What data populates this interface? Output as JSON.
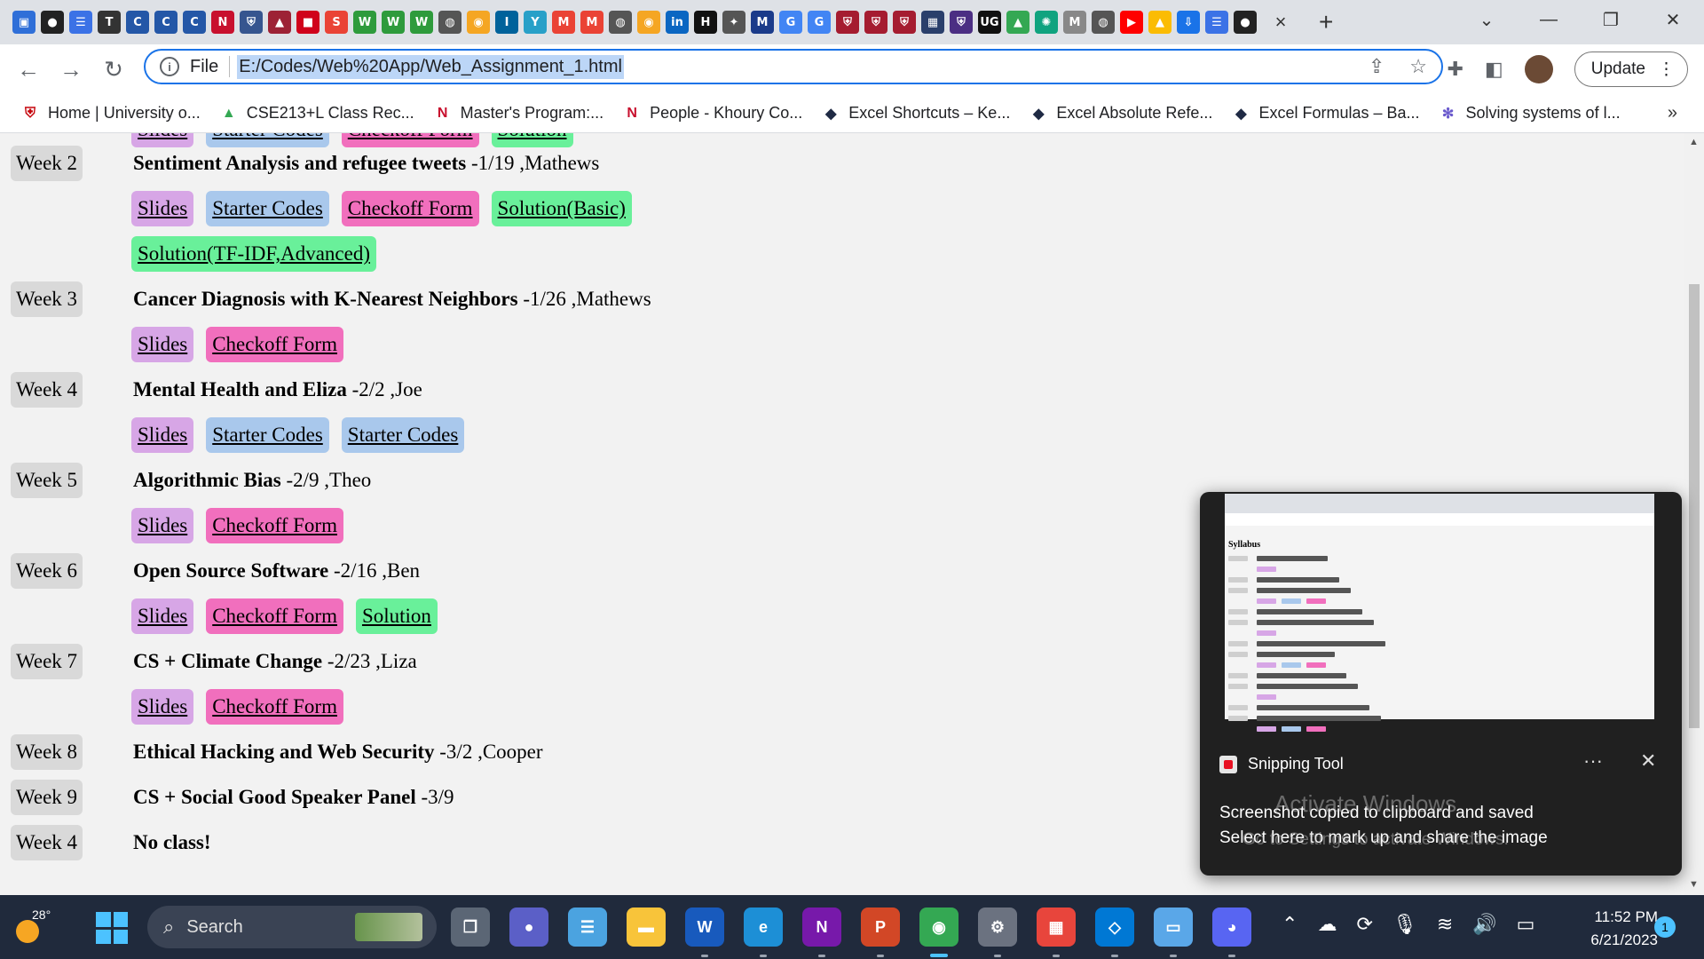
{
  "browser": {
    "tab_close": "×",
    "new_tab": "+",
    "tab_icons": [
      {
        "name": "lastpass-icon",
        "glyph": "▣",
        "color": "#2f6fd8"
      },
      {
        "name": "github-icon",
        "glyph": "●",
        "color": "#222"
      },
      {
        "name": "docs-icon",
        "glyph": "☰",
        "color": "#3b72e6"
      },
      {
        "name": "t-icon",
        "glyph": "T",
        "color": "#333"
      },
      {
        "name": "c-icon-1",
        "glyph": "C",
        "color": "#2457a7"
      },
      {
        "name": "c-icon-2",
        "glyph": "C",
        "color": "#2457a7"
      },
      {
        "name": "c-icon-3",
        "glyph": "C",
        "color": "#2457a7"
      },
      {
        "name": "northeastern-icon",
        "glyph": "N",
        "color": "#c8102e"
      },
      {
        "name": "shield-icon",
        "glyph": "⛨",
        "color": "#36558f"
      },
      {
        "name": "stevens-icon",
        "glyph": "▲",
        "color": "#9d2235"
      },
      {
        "name": "red-icon",
        "glyph": "■",
        "color": "#d0021b"
      },
      {
        "name": "swirl-icon",
        "glyph": "S",
        "color": "#ea4335"
      },
      {
        "name": "w-icon-1",
        "glyph": "W",
        "color": "#2e9b3c"
      },
      {
        "name": "w-icon-2",
        "glyph": "W",
        "color": "#2e9b3c"
      },
      {
        "name": "w-icon-3",
        "glyph": "W",
        "color": "#2e9b3c"
      },
      {
        "name": "globe-icon-1",
        "glyph": "◍",
        "color": "#555"
      },
      {
        "name": "orange-icon-1",
        "glyph": "◉",
        "color": "#f5a623"
      },
      {
        "name": "ieee-icon",
        "glyph": "I",
        "color": "#00629b"
      },
      {
        "name": "y-icon",
        "glyph": "Y",
        "color": "#28a0c8"
      },
      {
        "name": "gmail-icon-1",
        "glyph": "M",
        "color": "#ea4335"
      },
      {
        "name": "gmail-icon-2",
        "glyph": "M",
        "color": "#ea4335"
      },
      {
        "name": "globe-icon-2",
        "glyph": "◍",
        "color": "#555"
      },
      {
        "name": "orange-icon-2",
        "glyph": "◉",
        "color": "#f5a623"
      },
      {
        "name": "linkedin-icon",
        "glyph": "in",
        "color": "#0a66c2"
      },
      {
        "name": "hackerrank-icon",
        "glyph": "H",
        "color": "#111"
      },
      {
        "name": "ai-icon",
        "glyph": "✦",
        "color": "#555"
      },
      {
        "name": "m-icon",
        "glyph": "M",
        "color": "#1b3b8a"
      },
      {
        "name": "google-icon-1",
        "glyph": "G",
        "color": "#4285f4"
      },
      {
        "name": "google-icon-2",
        "glyph": "G",
        "color": "#4285f4"
      },
      {
        "name": "harvard-icon-1",
        "glyph": "⛨",
        "color": "#a51c30"
      },
      {
        "name": "harvard-icon-2",
        "glyph": "⛨",
        "color": "#a51c30"
      },
      {
        "name": "harvard-icon-3",
        "glyph": "⛨",
        "color": "#a51c30"
      },
      {
        "name": "pattern-icon",
        "glyph": "▦",
        "color": "#2a3f6b"
      },
      {
        "name": "crest-icon",
        "glyph": "⛨",
        "color": "#4b2e83"
      },
      {
        "name": "ug-icon",
        "glyph": "UG",
        "color": "#111"
      },
      {
        "name": "drive-icon",
        "glyph": "▲",
        "color": "#34a853"
      },
      {
        "name": "chatgpt-icon",
        "glyph": "✺",
        "color": "#10a37f"
      },
      {
        "name": "mi-icon",
        "glyph": "M",
        "color": "#888"
      },
      {
        "name": "globe-icon-3",
        "glyph": "◍",
        "color": "#555"
      },
      {
        "name": "youtube-icon",
        "glyph": "▶",
        "color": "#ff0000"
      },
      {
        "name": "drive-icon-2",
        "glyph": "▲",
        "color": "#fbbc04"
      },
      {
        "name": "download-icon",
        "glyph": "⇩",
        "color": "#1a73e8"
      },
      {
        "name": "docs-icon-2",
        "glyph": "☰",
        "color": "#3b72e6"
      },
      {
        "name": "github-icon-2",
        "glyph": "●",
        "color": "#222"
      }
    ],
    "window_controls": {
      "minimize": "—",
      "restore": "❐",
      "close": "✕",
      "dropdown": "⌄"
    },
    "nav": {
      "back": "←",
      "forward": "→",
      "reload": "↻"
    },
    "omnibox": {
      "info": "i",
      "scheme_label": "File",
      "url": "E:/Codes/Web%20App/Web_Assignment_1.html"
    },
    "update_label": "Update",
    "bookmarks": [
      {
        "label": "Home | University o...",
        "icon": "⛨",
        "color": "#c5050c"
      },
      {
        "label": "CSE213+L Class Rec...",
        "icon": "▲",
        "color": "#34a853"
      },
      {
        "label": "Master's Program:...",
        "icon": "N",
        "color": "#c8102e"
      },
      {
        "label": "People - Khoury Co...",
        "icon": "N",
        "color": "#c8102e"
      },
      {
        "label": "Excel Shortcuts – Ke...",
        "icon": "◆",
        "color": "#1f2a44"
      },
      {
        "label": "Excel Absolute Refe...",
        "icon": "◆",
        "color": "#1f2a44"
      },
      {
        "label": "Excel Formulas – Ba...",
        "icon": "◆",
        "color": "#1f2a44"
      },
      {
        "label": "Solving systems of l...",
        "icon": "✻",
        "color": "#6a5acd"
      }
    ],
    "bookmarks_more": "»"
  },
  "syllabus": {
    "partial_row": [
      "Slides",
      "Starter Codes",
      "Checkoff Form",
      "Solution"
    ],
    "weeks": [
      {
        "week": "Week 2",
        "title": "Sentiment Analysis and refugee tweets",
        "detail": " -1/19 ,Mathews",
        "links": [
          [
            "Slides",
            "Starter Codes",
            "Checkoff Form",
            "Solution(Basic)"
          ],
          [
            "Solution(TF-IDF,Advanced)"
          ]
        ]
      },
      {
        "week": "Week 3",
        "title": "Cancer Diagnosis with K-Nearest Neighbors",
        "detail": " -1/26 ,Mathews",
        "links": [
          [
            "Slides",
            "Checkoff Form"
          ]
        ]
      },
      {
        "week": "Week 4",
        "title": "Mental Health and Eliza",
        "detail": " -2/2 ,Joe",
        "links": [
          [
            "Slides",
            "Starter Codes",
            "Starter Codes"
          ]
        ]
      },
      {
        "week": "Week 5",
        "title": "Algorithmic Bias",
        "detail": " -2/9 ,Theo",
        "links": [
          [
            "Slides",
            "Checkoff Form"
          ]
        ]
      },
      {
        "week": "Week 6",
        "title": "Open Source Software",
        "detail": " -2/16 ,Ben",
        "links": [
          [
            "Slides",
            "Checkoff Form",
            "Solution"
          ]
        ]
      },
      {
        "week": "Week 7",
        "title": "CS + Climate Change",
        "detail": " -2/23 ,Liza",
        "links": [
          [
            "Slides",
            "Checkoff Form"
          ]
        ]
      },
      {
        "week": "Week 8",
        "title": "Ethical Hacking and Web Security",
        "detail": " -3/2 ,Cooper",
        "links": []
      },
      {
        "week": "Week 9",
        "title": "CS + Social Good Speaker Panel",
        "detail": " -3/9",
        "links": []
      },
      {
        "week": "Week 4",
        "title": "No class!",
        "detail": "",
        "links": []
      }
    ]
  },
  "notification": {
    "app": "Snipping Tool",
    "more": "···",
    "close": "✕",
    "line1": "Screenshot copied to clipboard and saved",
    "line2": "Select here to mark up and share the image",
    "thumb_heading": "Syllabus"
  },
  "watermark": {
    "line1": "Activate Windows",
    "line2": "Go to Settings to activate Windows."
  },
  "taskbar": {
    "temperature": "28°",
    "search_label": "Search",
    "time": "11:52 PM",
    "date": "6/21/2023",
    "notification_count": "1",
    "apps": [
      {
        "name": "task-view-icon",
        "glyph": "❐",
        "color": "#5b6675"
      },
      {
        "name": "teams-icon",
        "glyph": "●",
        "color": "#5b5fc7"
      },
      {
        "name": "notepad-icon",
        "glyph": "☰",
        "color": "#4ba3e0"
      },
      {
        "name": "file-explorer-icon",
        "glyph": "▬",
        "color": "#f8c43a"
      },
      {
        "name": "word-icon",
        "glyph": "W",
        "color": "#185abd"
      },
      {
        "name": "edge-icon",
        "glyph": "e",
        "color": "#1d8fd6"
      },
      {
        "name": "onenote-icon",
        "glyph": "N",
        "color": "#7719aa"
      },
      {
        "name": "powerpoint-icon",
        "glyph": "P",
        "color": "#d24726"
      },
      {
        "name": "chrome-icon",
        "glyph": "◉",
        "color": "#34a853"
      },
      {
        "name": "settings-icon",
        "glyph": "⚙",
        "color": "#6b7280"
      },
      {
        "name": "store-icon",
        "glyph": "▦",
        "color": "#e8453c"
      },
      {
        "name": "vscode-icon",
        "glyph": "◇",
        "color": "#0078d4"
      },
      {
        "name": "remote-desktop-icon",
        "glyph": "▭",
        "color": "#5aa7e8"
      },
      {
        "name": "discord-icon",
        "glyph": "◕",
        "color": "#5865f2"
      }
    ],
    "tray": [
      "⌃",
      "☁",
      "⟳",
      "🎙",
      "≋",
      "🔊",
      "▭"
    ]
  },
  "colors": {
    "slides": "#d7a6e6",
    "starter": "#a9c8ec",
    "checkoff": "#f16fbd",
    "solution": "#69f09a",
    "chrome_accent": "#1a73e8"
  }
}
